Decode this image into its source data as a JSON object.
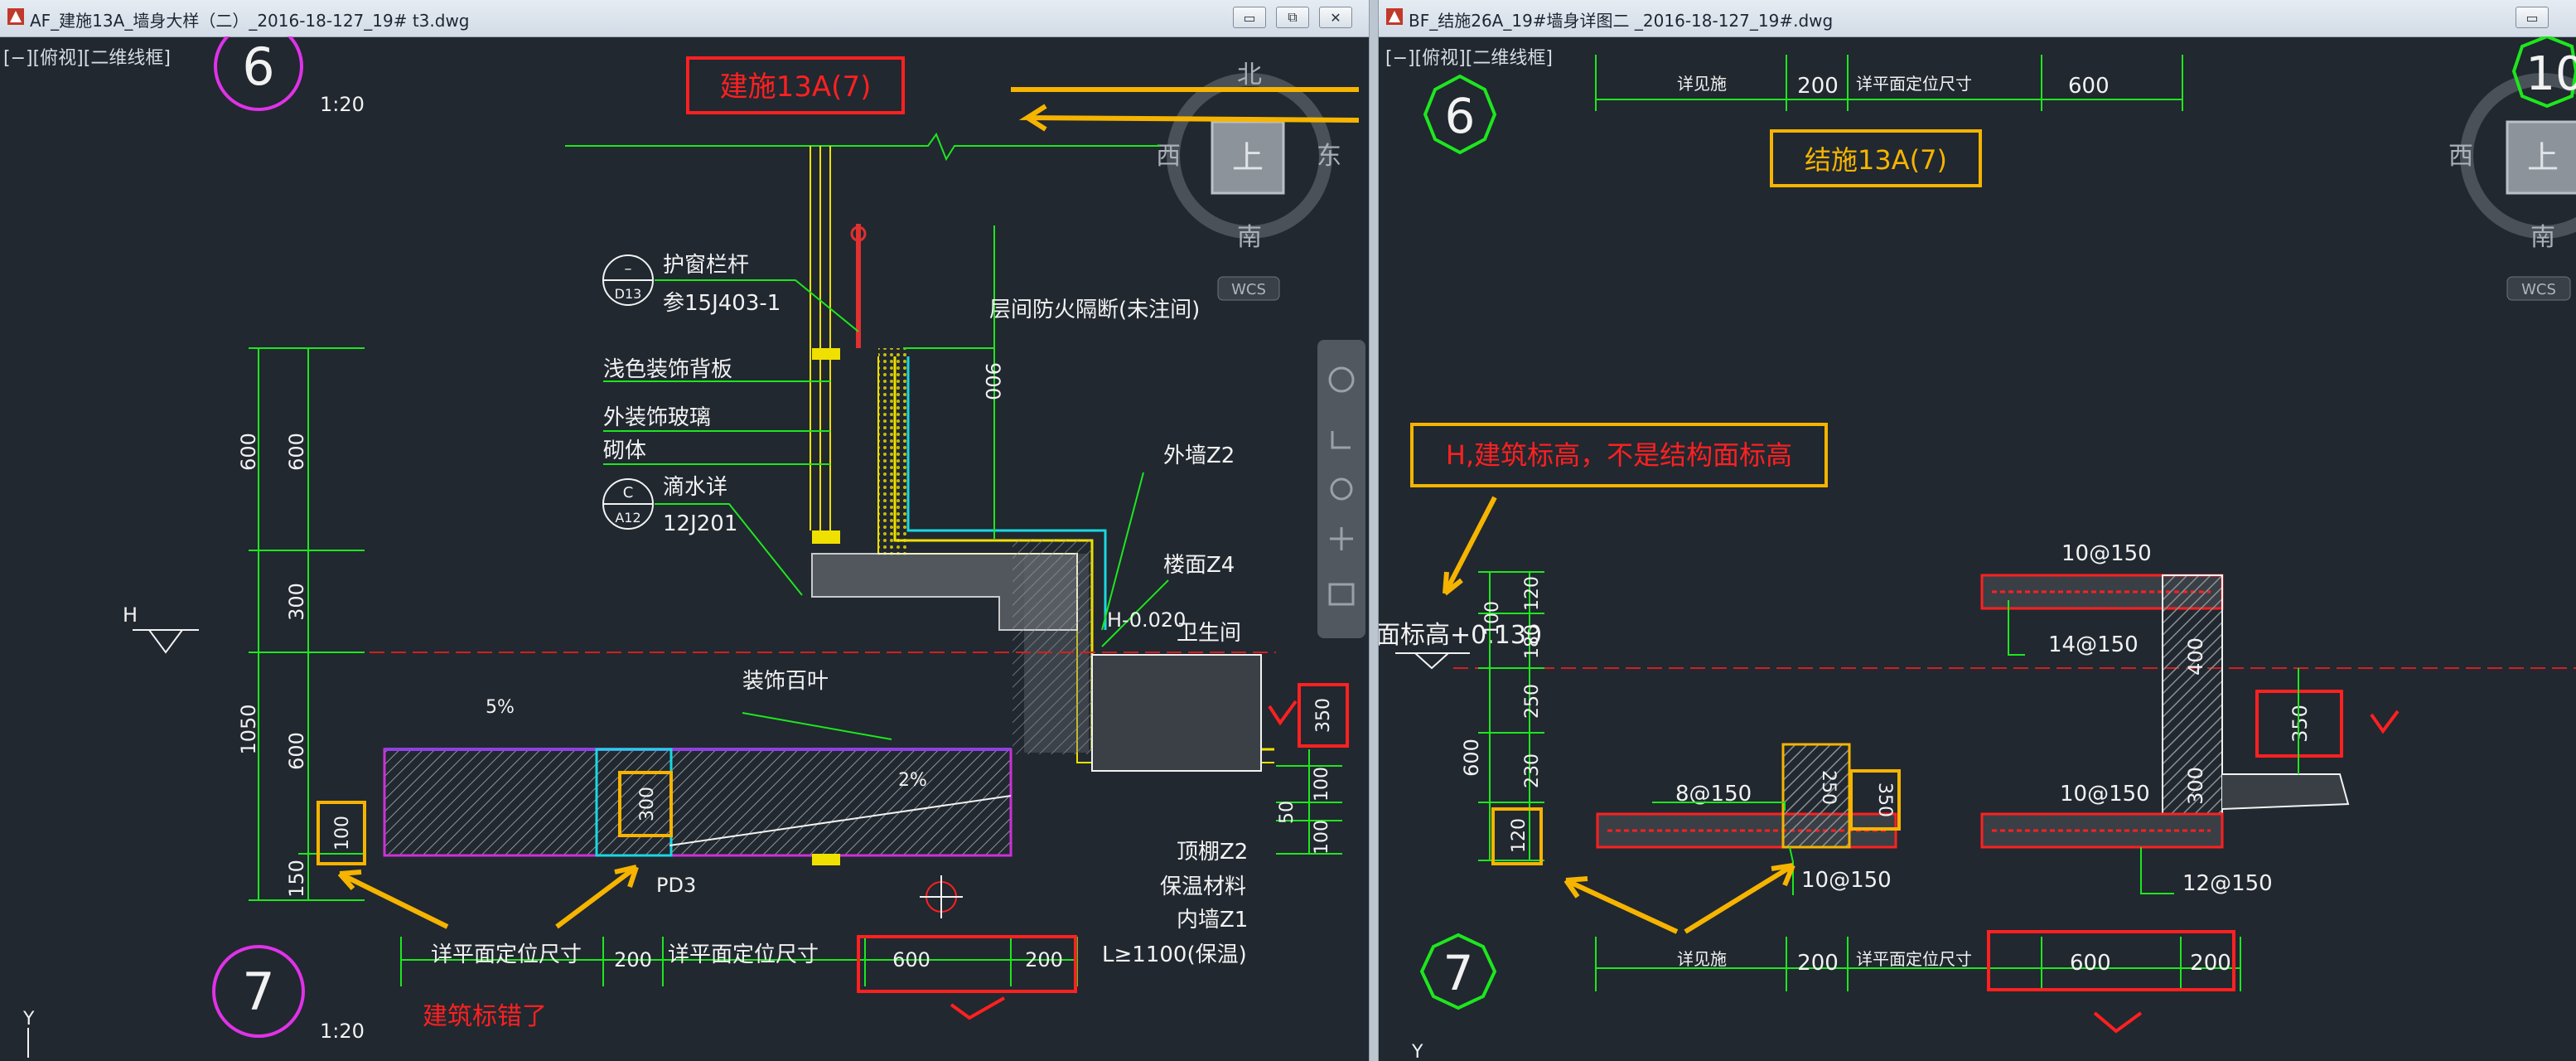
{
  "left_window": {
    "title": "AF_建施13A_墙身大样（二）_2016-18-127_19# t3.dwg",
    "viewport_label": "[−][俯视][二维线框]",
    "buttons": {
      "minimize": "▭",
      "restore": "⧉",
      "close": "✕"
    },
    "viewcube": {
      "north": "北",
      "south": "南",
      "west": "西",
      "east": "东",
      "top": "上",
      "wcs": "WCS"
    },
    "drawing": {
      "detail_6_number": "6",
      "detail_7_number": "7",
      "scale_top": "1:20",
      "scale_bottom": "1:20",
      "sheet_ref": "建施13A(7)",
      "callout_d13_top": "–",
      "callout_d13_bottom": "D13",
      "callout_a12_top": "C",
      "callout_a12_bottom": "A12",
      "label_railing": "护窗栏杆",
      "label_railing_ref": "参15J403-1",
      "label_fire_stop": "层间防火隔断(未注间)",
      "label_panel": "浅色装饰背板",
      "label_glass": "外装饰玻璃",
      "label_masonry": "砌体",
      "label_drip": "滴水详",
      "label_drip_ref": "12J201",
      "label_wall_z2": "外墙Z2",
      "label_floor_z4": "楼面Z4",
      "label_elev": "H-0.020",
      "label_bath": "卫生间",
      "label_louver": "装饰百叶",
      "label_slope_top": "5%",
      "label_slope_mid": "2%",
      "label_h": "H",
      "label_pd3": "PD3",
      "label_ceiling": "顶棚Z2",
      "label_insulation": "保温材料",
      "label_inner_wall": "内墙Z1",
      "label_length": "L≥1100(保温)",
      "dim_900": "900",
      "dim_600a": "600",
      "dim_600b": "600",
      "dim_600c": "600",
      "dim_300": "300",
      "dim_1050": "1050",
      "dim_150": "150",
      "dim_100_box": "100",
      "dim_300_box": "300",
      "dim_350_box": "350",
      "dim_100a": "100",
      "dim_50": "50",
      "dim_100b": "100",
      "bottom_plan_left": "详平面定位尺寸",
      "bottom_200a": "200",
      "bottom_plan_right": "详平面定位尺寸",
      "bottom_600": "600",
      "bottom_200b": "200",
      "annotation_error": "建筑标错了",
      "axis_y": "Y"
    }
  },
  "right_window": {
    "title": "BF_结施26A_19#墙身详图二 _2016-18-127_19#.dwg",
    "viewport_label": "[−][俯视][二维线框]",
    "buttons": {
      "minimize": "▭"
    },
    "viewcube": {
      "west": "西",
      "top": "上",
      "south": "南",
      "wcs": "WCS"
    },
    "drawing": {
      "detail_6_number": "6",
      "detail_10_number": "10",
      "detail_7_number": "7",
      "top_dim_label_a": "详见施",
      "top_dim_200": "200",
      "top_dim_label_b": "详平面定位尺寸",
      "top_dim_600": "600",
      "sheet_ref": "结施13A(7)",
      "annotation": "H,建筑标高，不是结构面标高",
      "partial_label": "面标高+0.130",
      "rebar_10_150_top": "10@150",
      "rebar_14_150": "14@150",
      "rebar_8_150": "8@150",
      "rebar_10_150_left": "10@150",
      "rebar_10_150_mid": "10@150",
      "rebar_12_150": "12@150",
      "dim_120a": "120",
      "dim_100": "100",
      "dim_180": "180",
      "dim_250": "250",
      "dim_600": "600",
      "dim_230": "230",
      "dim_120b": "120",
      "dim_250_beam": "250",
      "dim_350_box_left": "350",
      "dim_400": "400",
      "dim_350_box_right": "350",
      "dim_300": "300",
      "bottom_label_a": "详见施",
      "bottom_200a": "200",
      "bottom_label_b": "详平面定位尺寸",
      "bottom_600": "600",
      "bottom_200b": "200",
      "axis_y": "Y"
    }
  },
  "colors": {
    "canvas": "#212830",
    "green": "#1ee61e",
    "yellow": "#f0e000",
    "cyan": "#19d8e0",
    "magenta": "#e032e8",
    "red": "#ff2020",
    "orange": "#f6b400",
    "white": "#f2f2f2",
    "purple": "#9040e0"
  }
}
